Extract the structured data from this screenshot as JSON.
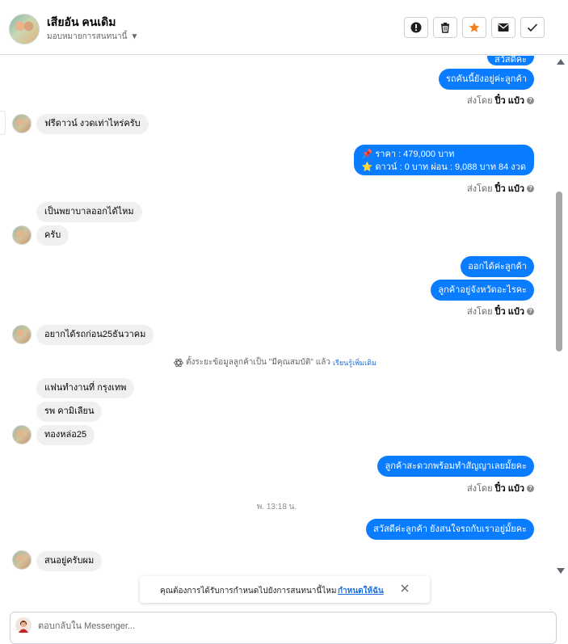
{
  "header": {
    "contact_name": "เสียอัน คนเดิม",
    "assign_label": "มอบหมายการสนทนานี้"
  },
  "colors": {
    "outgoing_bubble": "#0a7cff",
    "incoming_bubble": "#f0f0f0",
    "star_icon": "#f5821f",
    "link": "#216fdb"
  },
  "toolbar": {
    "icons": [
      "alert-icon",
      "trash-icon",
      "star-icon",
      "mail-icon",
      "check-icon"
    ]
  },
  "messages": {
    "out_1_partial": "สวัสดีคะ",
    "out_2": "รถคันนี้ยังอยู่ค่ะลูกค้า",
    "in_1": "ฟรีดาวน์ งวดเท่าไหร่ครับ",
    "out_price_line1": "📌 ราคา : 479,000 บาท",
    "out_price_line2": "⭐ ดาวน์ : 0 บาท ผ่อน : 9,088 บาท 84 งวด",
    "in_2": "เป็นพยาบาลออกได้ไหม",
    "in_3": "ครับ",
    "out_3": "ออกได้ค่ะลูกค้า",
    "out_4": "ลูกค้าอยู่จังหวัดอะไรคะ",
    "in_4": "อยากได้รถก่อน25ธันวาคม",
    "in_5": "แฟนทำงานที่ กรุงเทพ",
    "in_6": "รพ คามิเลียน",
    "in_7": "ทองหล่อ25",
    "out_5": "ลูกค้าสะดวกพร้อมทำสัญญาเลยมั้ยคะ",
    "out_6": "สวัสดีค่ะลูกค้า ยังสนใจรถกับเราอยู่มั้ยคะ",
    "in_8": "สนอยู่ครับผม"
  },
  "sent_by": {
    "prefix": "ส่งโดย",
    "agent": "ปิ๋ว แป๋ว"
  },
  "system_note": {
    "text": "ตั้งระยะข้อมูลลูกค้าเป็น \"มีคุณสมบัติ\" แล้ว",
    "link": "เรียนรู้เพิ่มเติม"
  },
  "time_separator": "พ. 13:18 น.",
  "banner": {
    "text": "คุณต้องการได้รับการกำหนดไปยังการสนทนานี้ไหม",
    "action": "กำหนดให้ฉัน"
  },
  "composer": {
    "placeholder": "ตอบกลับใน Messenger..."
  }
}
